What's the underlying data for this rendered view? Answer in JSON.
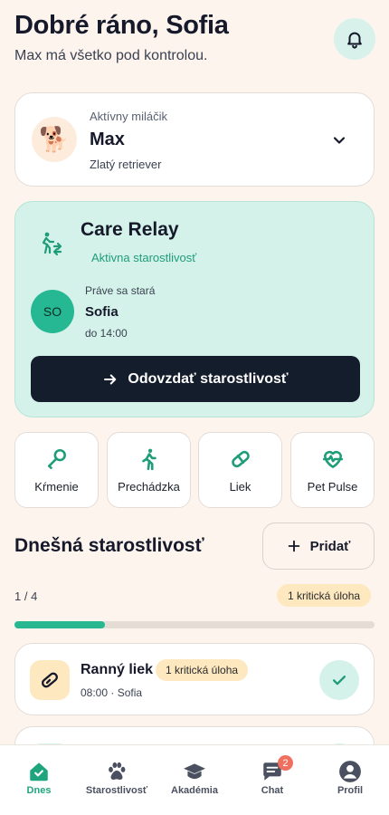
{
  "header": {
    "greeting": "Dobré ráno, Sofia",
    "subtitle": "Max má všetko pod kontrolou."
  },
  "pet": {
    "caption": "Aktívny miláčik",
    "name": "Max",
    "breed": "Zlatý retriever",
    "avatar_emoji": "🐕"
  },
  "relay": {
    "title": "Care Relay",
    "status": "Aktivna starostlivosť",
    "avatar_initials": "SO",
    "caption": "Práve sa stará",
    "caregiver": "Sofia",
    "until": "do 14:00",
    "button_label": "Odovzdať starostlivosť"
  },
  "quick_actions": [
    {
      "label": "Kŕmenie",
      "icon": "feeding-icon"
    },
    {
      "label": "Prechádzka",
      "icon": "walk-icon"
    },
    {
      "label": "Liek",
      "icon": "pill-icon"
    },
    {
      "label": "Pet Pulse",
      "icon": "heart-pulse-icon"
    }
  ],
  "today": {
    "title": "Dnešná starostlivosť",
    "add_label": "Pridať",
    "progress_text": "1 / 4",
    "progress_fraction": 0.25,
    "critical_badge": "1 kritická úloha"
  },
  "tasks": [
    {
      "title": "Ranný liek",
      "badge": "1 kritická úloha",
      "meta": "08:00 · Sofia",
      "icon": "pill-icon",
      "done": true
    }
  ],
  "nav": {
    "items": [
      {
        "label": "Dnes",
        "icon": "home-icon",
        "active": true
      },
      {
        "label": "Starostlivosť",
        "icon": "paw-icon",
        "active": false
      },
      {
        "label": "Akadémia",
        "icon": "graduation-cap-icon",
        "active": false
      },
      {
        "label": "Chat",
        "icon": "chat-icon",
        "active": false,
        "badge": "2"
      },
      {
        "label": "Profil",
        "icon": "profile-icon",
        "active": false
      }
    ]
  },
  "colors": {
    "accent": "#27b892",
    "background": "#fdf4ee",
    "dark_button": "#141d2c",
    "warning_badge": "#fde8c0",
    "mint_card": "#d4f2ea",
    "notification": "#f07060"
  }
}
